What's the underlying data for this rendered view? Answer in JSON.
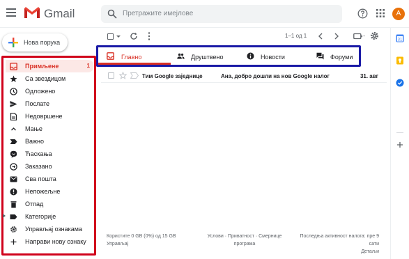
{
  "header": {
    "app_name": "Gmail",
    "search_placeholder": "Претражите имејлове",
    "avatar_letter": "A",
    "icons": [
      "menu-icon",
      "gmail-logo",
      "search-icon",
      "help-icon",
      "apps-icon"
    ]
  },
  "compose": {
    "label": "Нова порука"
  },
  "sidebar": {
    "items": [
      {
        "label": "Примљене",
        "count": "1",
        "icon": "inbox-icon",
        "active": true
      },
      {
        "label": "Са звездицом",
        "icon": "star-icon"
      },
      {
        "label": "Одложено",
        "icon": "clock-icon"
      },
      {
        "label": "Послате",
        "icon": "send-icon"
      },
      {
        "label": "Недовршене",
        "icon": "draft-icon"
      },
      {
        "label": "Мање",
        "icon": "chevron-up-icon"
      },
      {
        "label": "Важно",
        "icon": "label-important-icon"
      },
      {
        "label": "Ћаскања",
        "icon": "chat-icon"
      },
      {
        "label": "Заказано",
        "icon": "scheduled-icon"
      },
      {
        "label": "Сва пошта",
        "icon": "all-mail-icon"
      },
      {
        "label": "Непожељне",
        "icon": "spam-icon"
      },
      {
        "label": "Отпад",
        "icon": "trash-icon"
      },
      {
        "label": "Категорије",
        "icon": "label-icon"
      },
      {
        "label": "Управљај ознакама",
        "icon": "gear-icon"
      },
      {
        "label": "Направи нову ознаку",
        "icon": "plus-icon"
      }
    ]
  },
  "toolbar": {
    "range": "1–1 од 1",
    "icons": [
      "select-checkbox-icon",
      "refresh-icon",
      "more-icon",
      "chevron-left-icon",
      "chevron-right-icon",
      "input-tools-icon",
      "settings-icon"
    ]
  },
  "tabs": [
    {
      "label": "Главно",
      "icon": "inbox-icon",
      "active": true
    },
    {
      "label": "Друштвено",
      "icon": "people-icon"
    },
    {
      "label": "Новости",
      "icon": "info-icon"
    },
    {
      "label": "Форуми",
      "icon": "forum-icon"
    }
  ],
  "emails": [
    {
      "sender": "Тим Google заједнице",
      "subject": "Ана, добро дошли на нов Google налог",
      "date": "31. авг"
    }
  ],
  "footer": {
    "storage": "Користите 0 GB (0%) од 15 GB",
    "manage": "Управљај",
    "links": "Услови · Приватност · Смернице програма",
    "activity": "Последња активност налога: пре 9 сати",
    "details": "Детаљи"
  },
  "colors": {
    "accent": "#d93025",
    "sidebar_outline": "#d0021b",
    "tabs_outline": "#1a1aa6",
    "active_bg": "#fce8e6",
    "avatar": "#e8710a"
  }
}
